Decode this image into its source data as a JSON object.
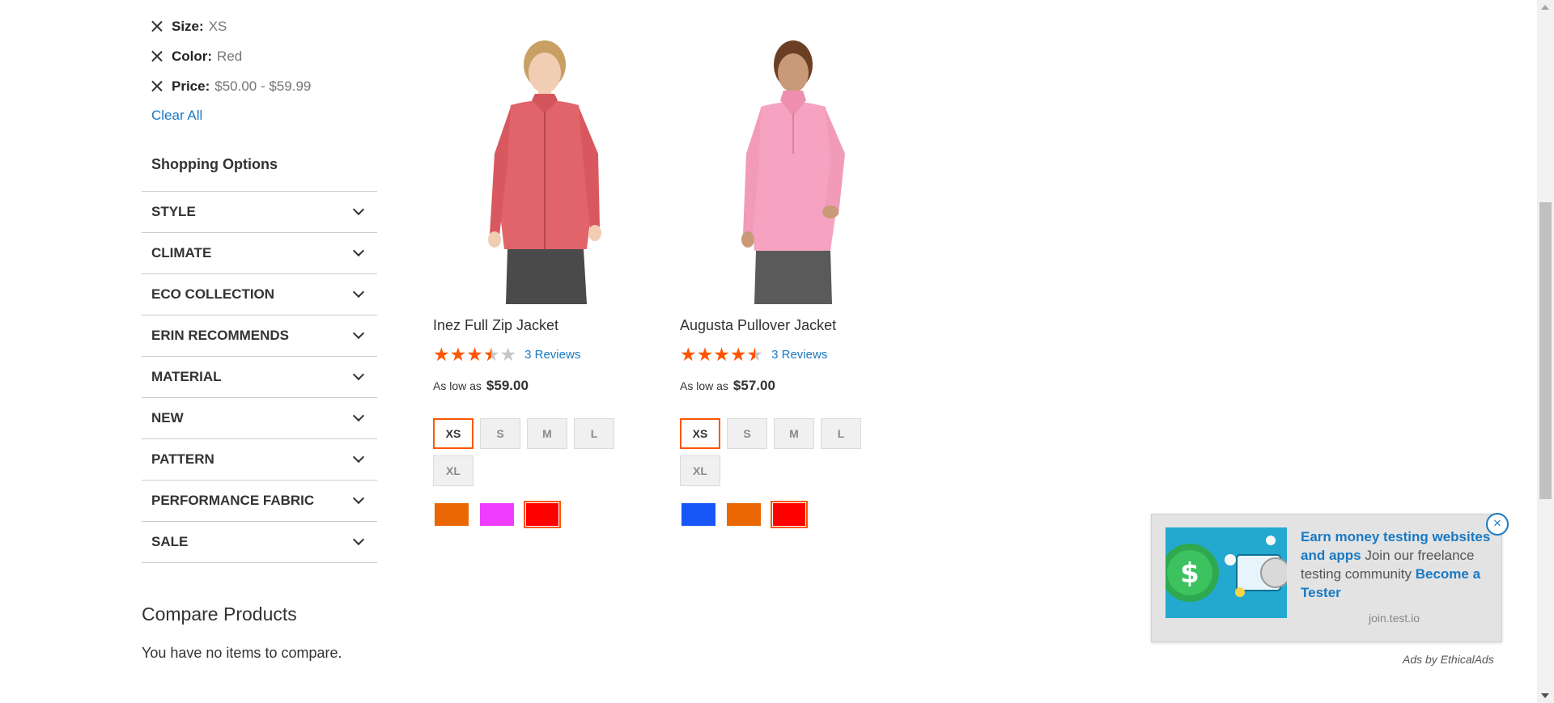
{
  "filters": [
    {
      "label": "Size:",
      "value": "XS"
    },
    {
      "label": "Color:",
      "value": "Red"
    },
    {
      "label": "Price:",
      "value": "$50.00 - $59.99"
    }
  ],
  "clear_all": "Clear All",
  "shopping_options": {
    "title": "Shopping Options",
    "items": [
      "STYLE",
      "CLIMATE",
      "ECO COLLECTION",
      "ERIN RECOMMENDS",
      "MATERIAL",
      "NEW",
      "PATTERN",
      "PERFORMANCE FABRIC",
      "SALE"
    ]
  },
  "compare": {
    "title": "Compare Products",
    "empty": "You have no items to compare."
  },
  "products": [
    {
      "name": "Inez Full Zip Jacket",
      "rating_stars": 3.5,
      "reviews": "3 Reviews",
      "price_prefix": "As low as",
      "price": "$59.00",
      "sizes": [
        "XS",
        "S",
        "M",
        "L",
        "XL"
      ],
      "selected_size": "XS",
      "colors": [
        "#eb6703",
        "#ef3dff",
        "#ff0000"
      ],
      "selected_color": "#ff0000",
      "garment_color": "#e0646a"
    },
    {
      "name": "Augusta Pullover Jacket",
      "rating_stars": 4.5,
      "reviews": "3 Reviews",
      "price_prefix": "As low as",
      "price": "$57.00",
      "sizes": [
        "XS",
        "S",
        "M",
        "L",
        "XL"
      ],
      "selected_size": "XS",
      "colors": [
        "#1857f7",
        "#eb6703",
        "#ff0000"
      ],
      "selected_color": "#ff0000",
      "garment_color": "#f5a3c0"
    }
  ],
  "ad": {
    "headline": "Earn money testing websites and apps",
    "body": " Join our freelance testing community ",
    "cta": "Become a Tester",
    "domain": "join.test.io",
    "close": "×",
    "attribution": "Ads by EthicalAds"
  },
  "colors": {
    "accent": "#ff5501",
    "link": "#1979c3"
  }
}
